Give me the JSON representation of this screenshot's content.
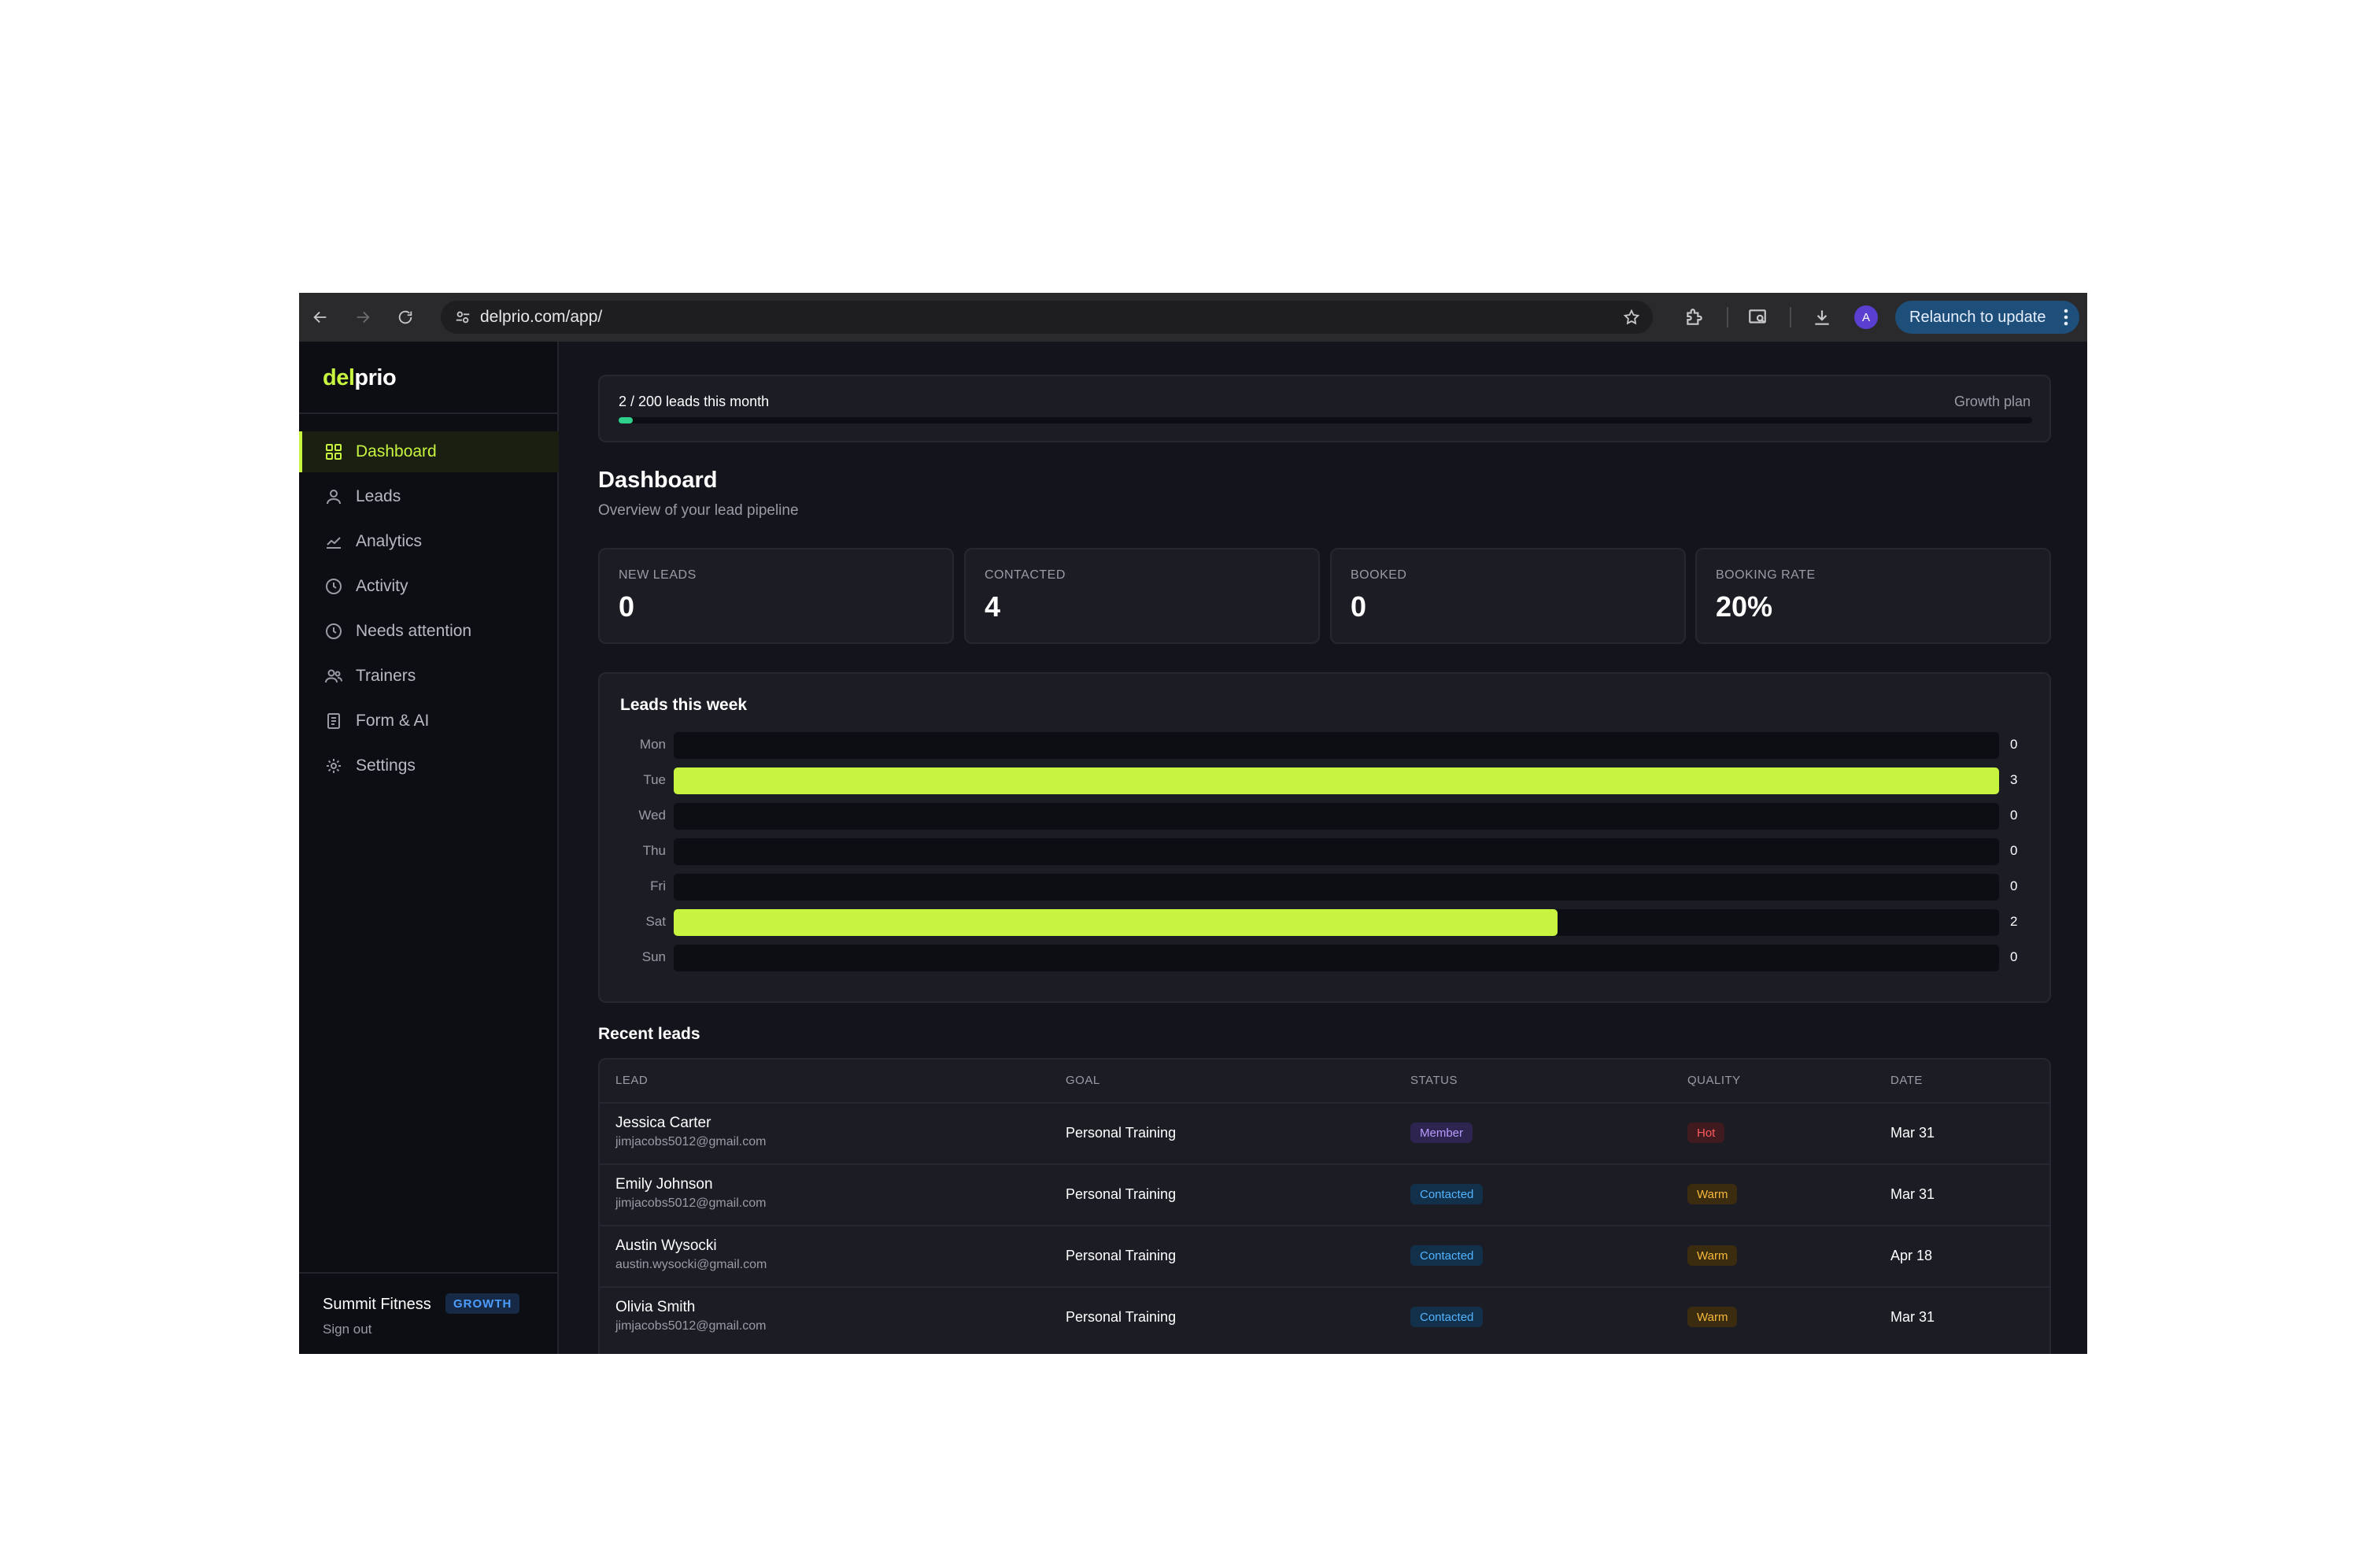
{
  "browser": {
    "url": "delprio.com/app/",
    "profile_initial": "A",
    "relaunch_label": "Relaunch to update"
  },
  "app": {
    "logo_accent": "del",
    "logo_rest": "prio",
    "accent_color": "#c6f43f"
  },
  "sidebar": {
    "items": [
      {
        "label": "Dashboard",
        "icon": "grid-icon",
        "active": true
      },
      {
        "label": "Leads",
        "icon": "user-icon"
      },
      {
        "label": "Analytics",
        "icon": "chart-line-icon"
      },
      {
        "label": "Activity",
        "icon": "clock-icon"
      },
      {
        "label": "Needs attention",
        "icon": "clock-icon"
      },
      {
        "label": "Trainers",
        "icon": "users-icon"
      },
      {
        "label": "Form & AI",
        "icon": "document-icon"
      },
      {
        "label": "Settings",
        "icon": "gear-icon"
      }
    ],
    "org_name": "Summit Fitness",
    "plan_badge": "GROWTH",
    "sign_out": "Sign out"
  },
  "usage": {
    "text": "2 / 200 leads this month",
    "plan": "Growth plan",
    "fraction": 0.01
  },
  "page": {
    "title": "Dashboard",
    "subtitle": "Overview of your lead pipeline"
  },
  "stats": [
    {
      "label": "NEW LEADS",
      "value": "0"
    },
    {
      "label": "CONTACTED",
      "value": "4"
    },
    {
      "label": "BOOKED",
      "value": "0"
    },
    {
      "label": "BOOKING RATE",
      "value": "20%"
    }
  ],
  "chart_data": {
    "type": "bar",
    "orientation": "horizontal",
    "title": "Leads this week",
    "categories": [
      "Mon",
      "Tue",
      "Wed",
      "Thu",
      "Fri",
      "Sat",
      "Sun"
    ],
    "values": [
      0,
      3,
      0,
      0,
      0,
      2,
      0
    ],
    "xlim": [
      0,
      3
    ],
    "grid": false,
    "bar_color": "#c6f43f"
  },
  "recent": {
    "title": "Recent leads",
    "columns": [
      "LEAD",
      "GOAL",
      "STATUS",
      "QUALITY",
      "DATE"
    ],
    "rows": [
      {
        "name": "Jessica Carter",
        "email": "jimjacobs5012@gmail.com",
        "goal": "Personal Training",
        "status": "Member",
        "quality": "Hot",
        "date": "Mar 31"
      },
      {
        "name": "Emily Johnson",
        "email": "jimjacobs5012@gmail.com",
        "goal": "Personal Training",
        "status": "Contacted",
        "quality": "Warm",
        "date": "Mar 31"
      },
      {
        "name": "Austin Wysocki",
        "email": "austin.wysocki@gmail.com",
        "goal": "Personal Training",
        "status": "Contacted",
        "quality": "Warm",
        "date": "Apr 18"
      },
      {
        "name": "Olivia Smith",
        "email": "jimjacobs5012@gmail.com",
        "goal": "Personal Training",
        "status": "Contacted",
        "quality": "Warm",
        "date": "Mar 31"
      }
    ]
  }
}
